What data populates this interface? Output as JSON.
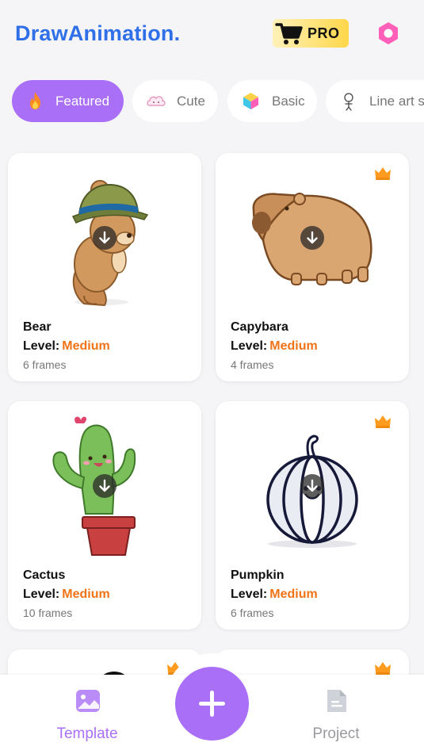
{
  "header": {
    "title": "DrawAnimation.",
    "pro_label": "PRO",
    "pro_icon": "cart-icon",
    "settings_icon": "hexagon-settings-icon"
  },
  "categories": [
    {
      "label": "Featured",
      "icon": "fire-icon",
      "active": true
    },
    {
      "label": "Cute",
      "icon": "cute-cloud-icon",
      "active": false
    },
    {
      "label": "Basic",
      "icon": "cube-icon",
      "active": false
    },
    {
      "label": "Line art s",
      "icon": "lineart-icon",
      "active": false
    }
  ],
  "templates": [
    {
      "name": "Bear",
      "level_label": "Level:",
      "level": "Medium",
      "frames": "6 frames",
      "premium": false
    },
    {
      "name": "Capybara",
      "level_label": "Level:",
      "level": "Medium",
      "frames": "4 frames",
      "premium": true
    },
    {
      "name": "Cactus",
      "level_label": "Level:",
      "level": "Medium",
      "frames": "10 frames",
      "premium": false
    },
    {
      "name": "Pumpkin",
      "level_label": "Level:",
      "level": "Medium",
      "frames": "6 frames",
      "premium": true
    }
  ],
  "bottom_nav": {
    "template_label": "Template",
    "project_label": "Project",
    "create_icon": "plus-icon"
  },
  "colors": {
    "accent": "#a970f7",
    "title_blue": "#2f6fe8",
    "level_orange": "#f07317",
    "background": "#f5f5f7"
  }
}
